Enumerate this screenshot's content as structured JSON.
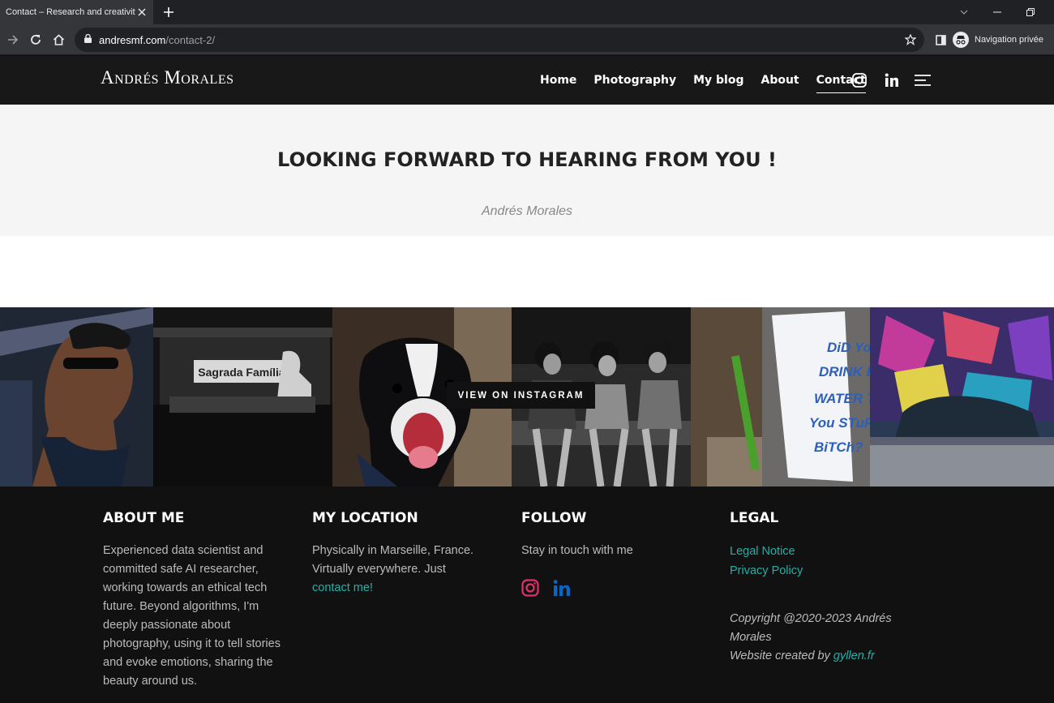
{
  "browser": {
    "tab_title": "Contact – Research and creativity",
    "url_domain": "andresmf.com",
    "url_path": "/contact-2/",
    "profile_label": "Navigation privée"
  },
  "header": {
    "logo": "Andrés Morales",
    "nav": [
      "Home",
      "Photography",
      "My blog",
      "About",
      "Contact"
    ],
    "active_nav": "Contact"
  },
  "hero": {
    "title": "LOOKING FORWARD TO HEARING FROM YOU !",
    "author": "Andrés Morales"
  },
  "instagram": {
    "cta": "VIEW ON INSTAGRAM",
    "photo_text": [
      "Sagrada Família",
      "DiD YoU DRINK ENOUGH WATER TODAY You STuPiD BiTCh?"
    ]
  },
  "footer": {
    "about": {
      "heading": "ABOUT ME",
      "text": "Experienced data scientist and committed safe AI researcher, working towards an ethical tech future.  Beyond algorithms, I'm deeply passionate about photography, using it to tell stories and evoke emotions, sharing the beauty around us."
    },
    "location": {
      "heading": "MY LOCATION",
      "text": "Physically in Marseille, France. Virtually everywhere. Just",
      "link": "contact me!"
    },
    "follow": {
      "heading": "FOLLOW",
      "text": "Stay in touch with me"
    },
    "legal": {
      "heading": "LEGAL",
      "links": [
        "Legal Notice",
        "Privacy Policy"
      ],
      "copyright": "Copyright @2020-2023 Andrés Morales",
      "credit_prefix": "Website created by",
      "credit_link": "gyllen.fr"
    }
  },
  "colors": {
    "accent": "#1fb1a8",
    "instagram": "#e1306c",
    "linkedin": "#0a66c2",
    "footer_bg": "#111111",
    "header_bg": "#181818"
  }
}
